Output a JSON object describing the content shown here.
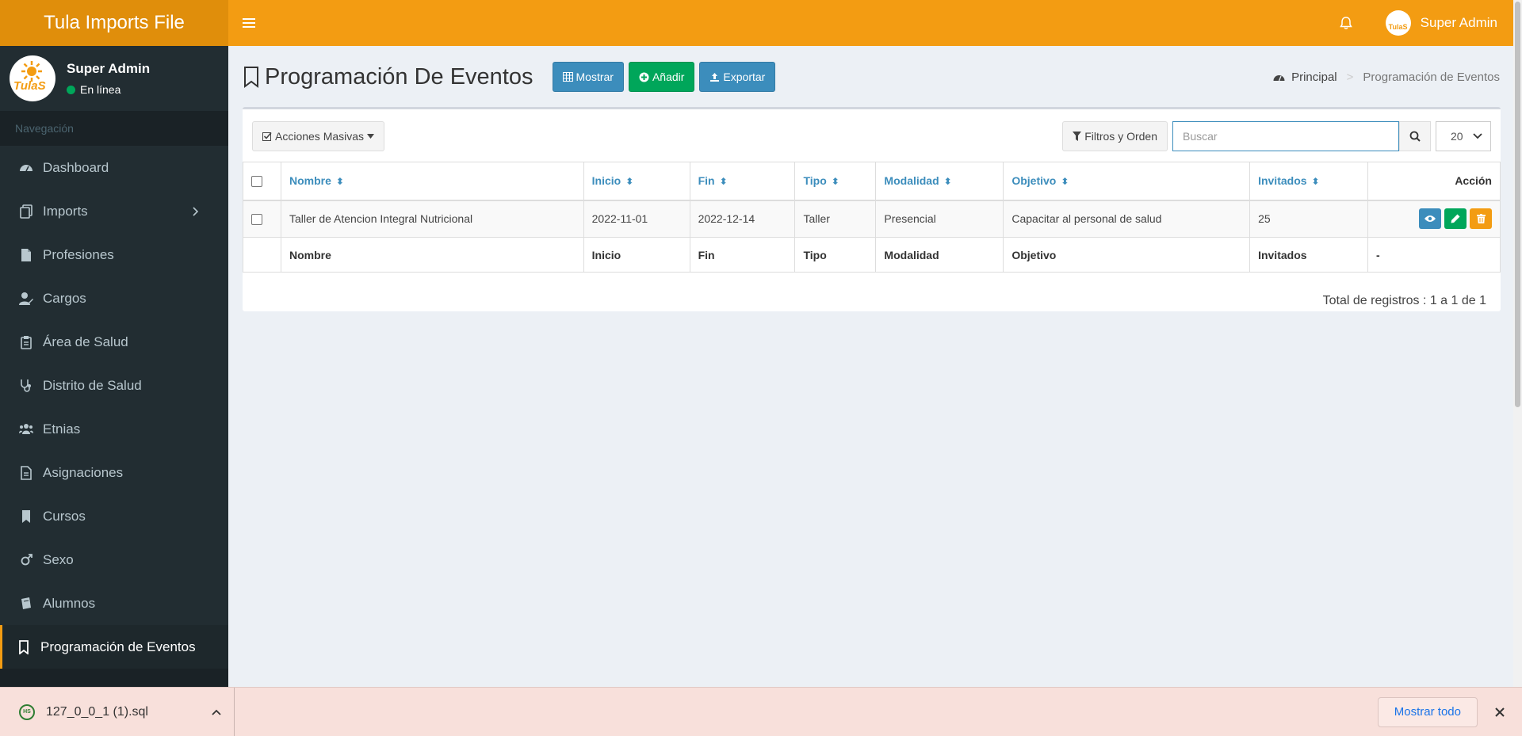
{
  "app": {
    "title": "Tula Imports File",
    "brand_mark": "TulaS"
  },
  "header": {
    "user_name": "Super Admin"
  },
  "sidebar": {
    "user_name": "Super Admin",
    "status": "En línea",
    "nav_header": "Navegación",
    "items": [
      {
        "label": "Dashboard",
        "icon": "dashboard-icon"
      },
      {
        "label": "Imports",
        "icon": "copy-icon",
        "has_submenu": true
      },
      {
        "label": "Profesiones",
        "icon": "file-icon"
      },
      {
        "label": "Cargos",
        "icon": "user-edit-icon"
      },
      {
        "label": "Área de Salud",
        "icon": "clipboard-icon"
      },
      {
        "label": "Distrito de Salud",
        "icon": "stethoscope-icon"
      },
      {
        "label": "Etnias",
        "icon": "users-icon"
      },
      {
        "label": "Asignaciones",
        "icon": "document-icon"
      },
      {
        "label": "Cursos",
        "icon": "bookmark-icon"
      },
      {
        "label": "Sexo",
        "icon": "gender-icon"
      },
      {
        "label": "Alumnos",
        "icon": "book-icon"
      },
      {
        "label": "Programación de Eventos",
        "icon": "bookmark-outline-icon",
        "active": true
      }
    ]
  },
  "page": {
    "title": "Programación De Eventos",
    "buttons": {
      "show": "Mostrar",
      "add": "Añadir",
      "export": "Exportar"
    },
    "breadcrumb": {
      "home": "Principal",
      "current": "Programación de Eventos"
    }
  },
  "toolbar": {
    "bulk_actions": "Acciones Masivas",
    "filters": "Filtros y Orden",
    "search_placeholder": "Buscar",
    "per_page": "20"
  },
  "table": {
    "columns": [
      "Nombre",
      "Inicio",
      "Fin",
      "Tipo",
      "Modalidad",
      "Objetivo",
      "Invitados"
    ],
    "action_header": "Acción",
    "rows": [
      {
        "nombre": "Taller de Atencion Integral Nutricional",
        "inicio": "2022-11-01",
        "fin": "2022-12-14",
        "tipo": "Taller",
        "modalidad": "Presencial",
        "objetivo": "Capacitar al personal de salud",
        "invitados": "25"
      }
    ],
    "footer_action": "-",
    "total": "Total de registros : 1 a 1 de 1"
  },
  "downloads": {
    "file_name": "127_0_0_1 (1).sql",
    "show_all": "Mostrar todo"
  },
  "colors": {
    "header": "#f39c12",
    "logo_bg": "#e08e0b",
    "sidebar": "#222d32",
    "primary": "#3c8dbc",
    "success": "#00a65a"
  }
}
